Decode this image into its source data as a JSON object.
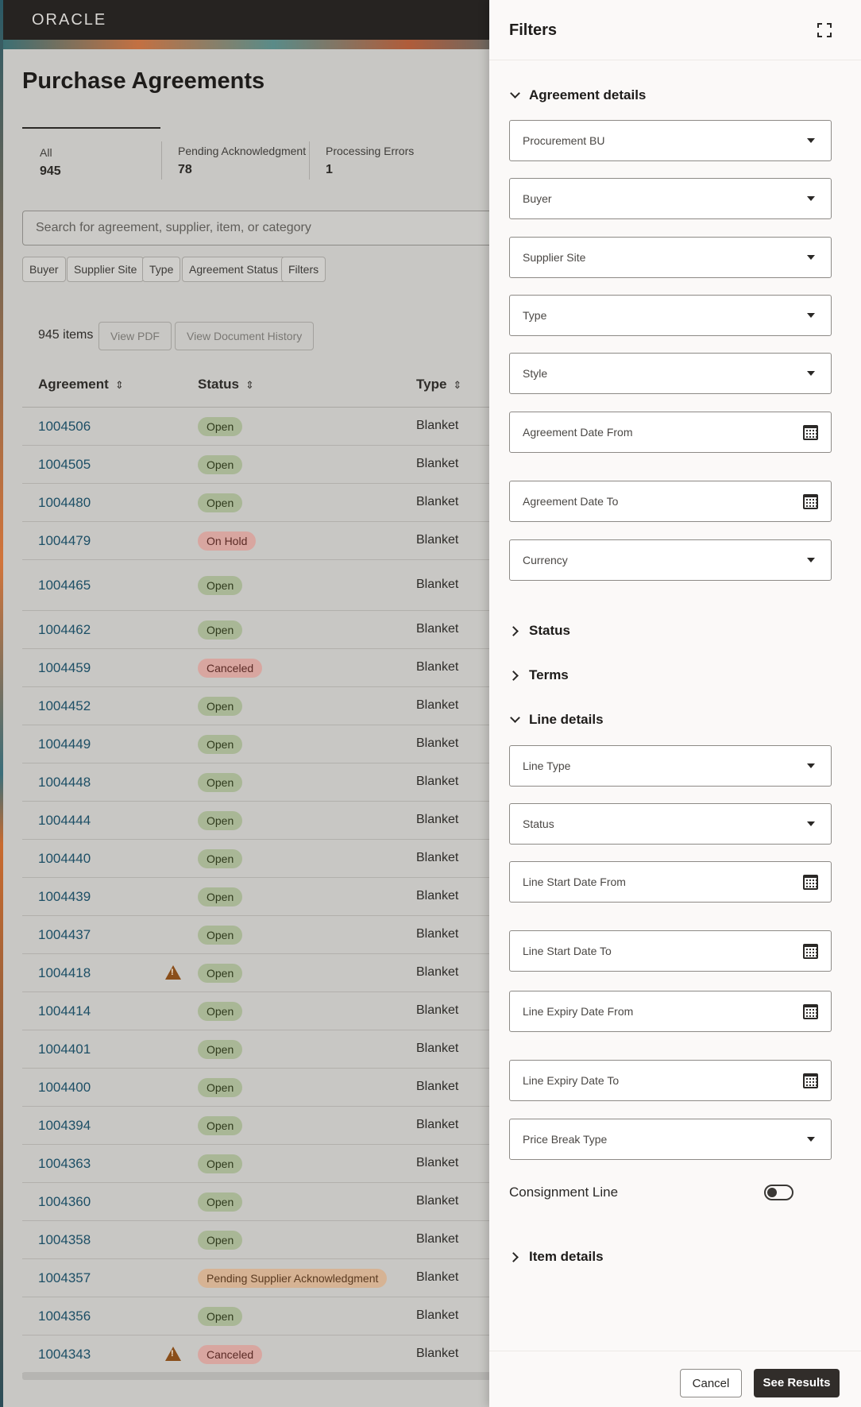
{
  "header": {
    "logo": "ORACLE"
  },
  "page": {
    "title": "Purchase Agreements"
  },
  "count_tabs": [
    {
      "label": "All",
      "value": "945"
    },
    {
      "label": "Pending Acknowledgment",
      "value": "78"
    },
    {
      "label": "Processing Errors",
      "value": "1"
    }
  ],
  "search": {
    "placeholder": "Search for agreement, supplier, item, or category"
  },
  "filter_chips": [
    "Buyer",
    "Supplier Site",
    "Type",
    "Agreement Status",
    "Filters"
  ],
  "toolbar": {
    "items_count": "945 items",
    "view_pdf": "View PDF",
    "view_history": "View Document History"
  },
  "table": {
    "columns": [
      "Agreement",
      "Status",
      "Type"
    ],
    "rows": [
      {
        "agreement": "1004506",
        "status": "Open",
        "type": "Blanket"
      },
      {
        "agreement": "1004505",
        "status": "Open",
        "type": "Blanket"
      },
      {
        "agreement": "1004480",
        "status": "Open",
        "type": "Blanket"
      },
      {
        "agreement": "1004479",
        "status": "On Hold",
        "type": "Blanket"
      },
      {
        "agreement": "1004465",
        "status": "Open",
        "type": "Blanket"
      },
      {
        "agreement": "1004462",
        "status": "Open",
        "type": "Blanket"
      },
      {
        "agreement": "1004459",
        "status": "Canceled",
        "type": "Blanket"
      },
      {
        "agreement": "1004452",
        "status": "Open",
        "type": "Blanket"
      },
      {
        "agreement": "1004449",
        "status": "Open",
        "type": "Blanket"
      },
      {
        "agreement": "1004448",
        "status": "Open",
        "type": "Blanket"
      },
      {
        "agreement": "1004444",
        "status": "Open",
        "type": "Blanket"
      },
      {
        "agreement": "1004440",
        "status": "Open",
        "type": "Blanket"
      },
      {
        "agreement": "1004439",
        "status": "Open",
        "type": "Blanket"
      },
      {
        "agreement": "1004437",
        "status": "Open",
        "type": "Blanket"
      },
      {
        "agreement": "1004418",
        "status": "Open",
        "type": "Blanket",
        "warning": true
      },
      {
        "agreement": "1004414",
        "status": "Open",
        "type": "Blanket"
      },
      {
        "agreement": "1004401",
        "status": "Open",
        "type": "Blanket"
      },
      {
        "agreement": "1004400",
        "status": "Open",
        "type": "Blanket"
      },
      {
        "agreement": "1004394",
        "status": "Open",
        "type": "Blanket"
      },
      {
        "agreement": "1004363",
        "status": "Open",
        "type": "Blanket"
      },
      {
        "agreement": "1004360",
        "status": "Open",
        "type": "Blanket"
      },
      {
        "agreement": "1004358",
        "status": "Open",
        "type": "Blanket"
      },
      {
        "agreement": "1004357",
        "status": "Pending Supplier Acknowledgment",
        "type": "Blanket"
      },
      {
        "agreement": "1004356",
        "status": "Open",
        "type": "Blanket"
      },
      {
        "agreement": "1004343",
        "status": "Canceled",
        "type": "Blanket",
        "warning": true
      }
    ]
  },
  "drawer": {
    "title": "Filters",
    "sections": {
      "agreement_details": "Agreement details",
      "status": "Status",
      "terms": "Terms",
      "line_details": "Line details",
      "item_details": "Item details"
    },
    "agreement_fields": [
      {
        "label": "Procurement BU",
        "kind": "select"
      },
      {
        "label": "Buyer",
        "kind": "select"
      },
      {
        "label": "Supplier Site",
        "kind": "select"
      },
      {
        "label": "Type",
        "kind": "select"
      },
      {
        "label": "Style",
        "kind": "select"
      },
      {
        "label": "Agreement Date From",
        "kind": "date"
      },
      {
        "label": "Agreement Date To",
        "kind": "date"
      },
      {
        "label": "Currency",
        "kind": "select"
      }
    ],
    "line_fields": [
      {
        "label": "Line Type",
        "kind": "select"
      },
      {
        "label": "Status",
        "kind": "select"
      },
      {
        "label": "Line Start Date From",
        "kind": "date"
      },
      {
        "label": "Line Start Date To",
        "kind": "date"
      },
      {
        "label": "Line Expiry Date From",
        "kind": "date"
      },
      {
        "label": "Line Expiry Date To",
        "kind": "date"
      },
      {
        "label": "Price Break Type",
        "kind": "select"
      }
    ],
    "consignment_label": "Consignment Line",
    "consignment_on": false,
    "cancel_label": "Cancel",
    "results_label": "See Results"
  }
}
